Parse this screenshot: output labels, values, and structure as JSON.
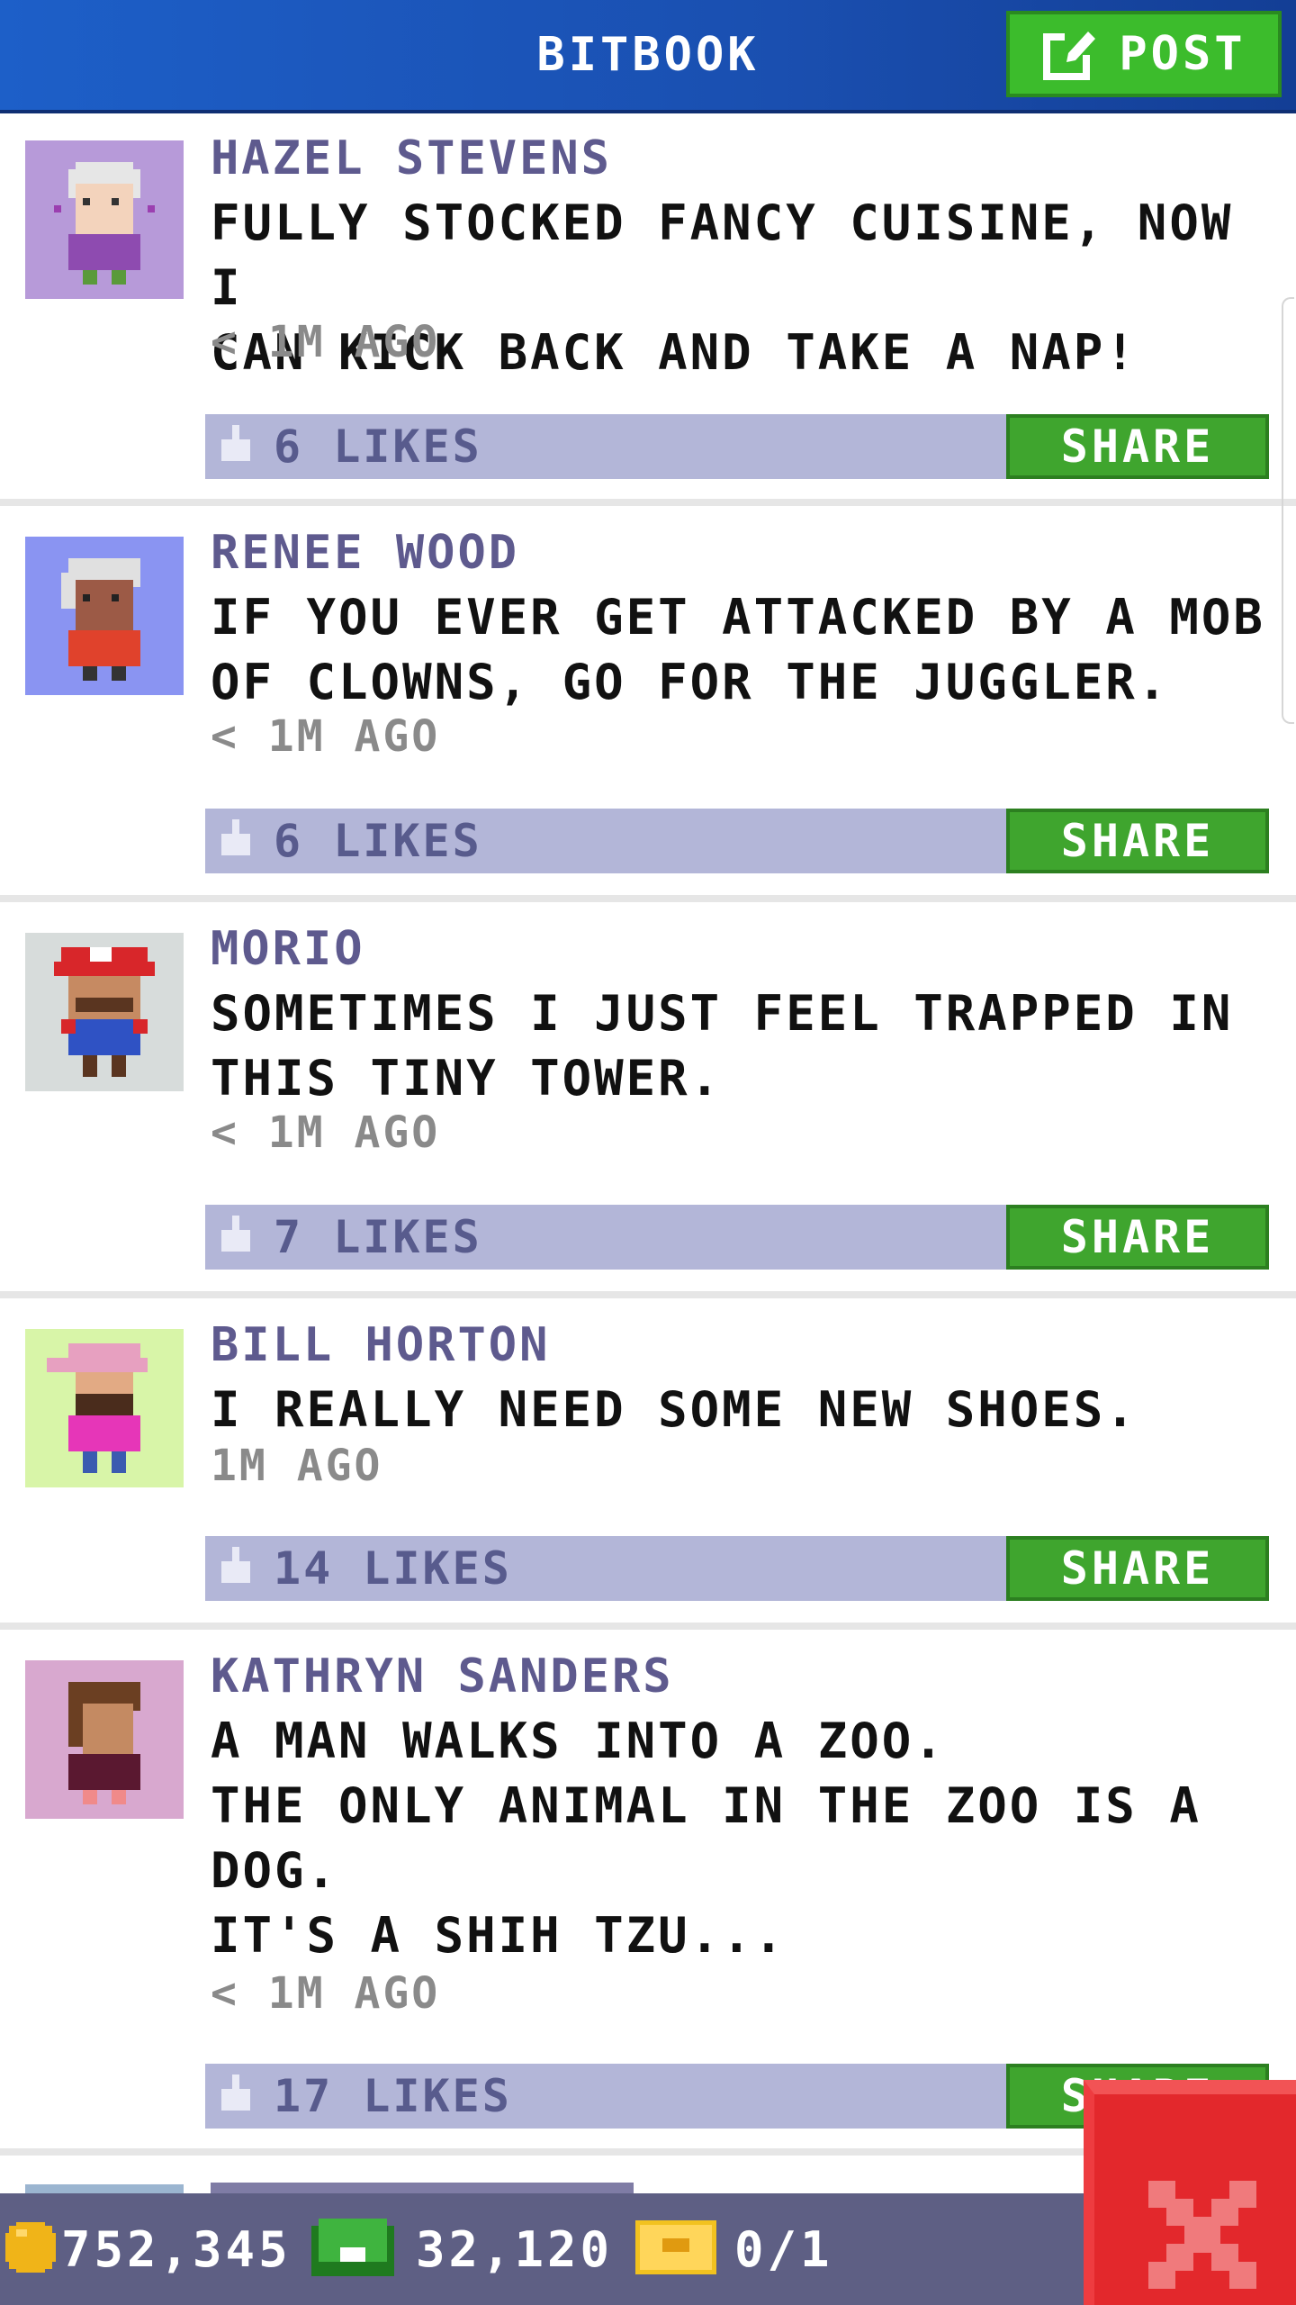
{
  "header": {
    "title": "BITBOOK",
    "post_label": "POST"
  },
  "posts": [
    {
      "author": "HAZEL STEVENS",
      "message": "FULLY STOCKED FANCY CUISINE, NOW I\nCAN KICK BACK AND TAKE A NAP!",
      "time": "< 1M AGO",
      "likes": "6 LIKES",
      "share_label": "SHARE",
      "avatar_bg": "#b79ad9"
    },
    {
      "author": "RENEE WOOD",
      "message": "IF YOU EVER GET ATTACKED BY A MOB\nOF CLOWNS, GO FOR THE JUGGLER.",
      "time": "< 1M AGO",
      "likes": "6 LIKES",
      "share_label": "SHARE",
      "avatar_bg": "#8a94f2"
    },
    {
      "author": "MORIO",
      "message": "SOMETIMES I JUST FEEL TRAPPED IN\nTHIS TINY TOWER.",
      "time": "< 1M AGO",
      "likes": "7 LIKES",
      "share_label": "SHARE",
      "avatar_bg": "#d7dcdb"
    },
    {
      "author": "BILL HORTON",
      "message": "I REALLY NEED SOME NEW SHOES.",
      "time": "1M AGO",
      "likes": "14 LIKES",
      "share_label": "SHARE",
      "avatar_bg": "#d8f5a8"
    },
    {
      "author": "KATHRYN SANDERS",
      "message": "A MAN WALKS INTO A ZOO.\nTHE ONLY ANIMAL IN THE ZOO IS A\nDOG.\nIT'S A SHIH TZU...",
      "time": "< 1M AGO",
      "likes": "17 LIKES",
      "share_label": "SHARE",
      "avatar_bg": "#d8a8cf"
    }
  ],
  "footer": {
    "coins": "752,345",
    "bux": "32,120",
    "tickets": "0/1"
  },
  "colors": {
    "header_blue": "#1d5fc8",
    "post_green": "#3cbc2c",
    "share_green": "#3fa52e",
    "like_bar": "#b3b6d8",
    "author_purple": "#5e5a8e",
    "footer_bg": "#5e5f84",
    "close_red": "#e3282c"
  },
  "icons": {
    "post": "edit-icon",
    "like": "thumbs-up-icon",
    "coin": "coin-icon",
    "bux": "bux-icon",
    "ticket": "ticket-icon",
    "close": "close-icon"
  }
}
